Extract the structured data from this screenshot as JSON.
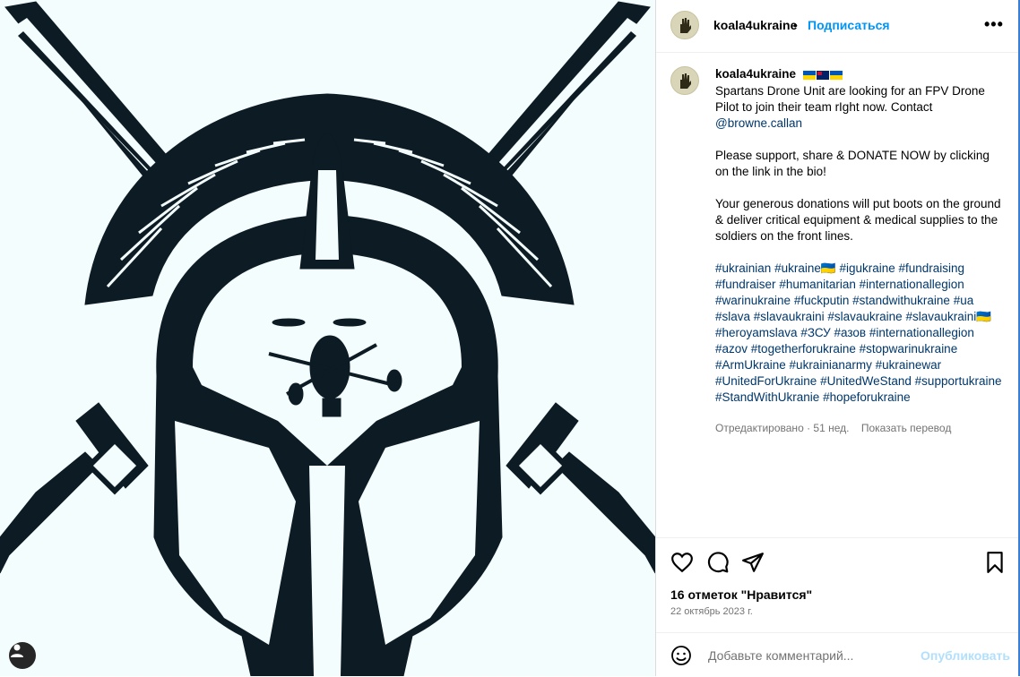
{
  "post": {
    "username": "koala4ukraine",
    "follow_label": "Подписаться",
    "more_label": "•••",
    "header_separator": "•",
    "avatar_icon": "hand-emblem-icon"
  },
  "caption": {
    "username": "koala4ukraine",
    "flags": [
      "ukraine-flag",
      "australia-flag",
      "ukraine-flag"
    ],
    "line1": "Spartans Drone Unit are looking for an FPV Drone Pilot to join their team rIght now. Contact ",
    "mention": "@browne.callan",
    "para2": "Please support, share & DONATE NOW by clicking on the link in the bio!",
    "para3": "Your generous donations will put boots on the ground & deliver critical equipment & medical supplies to the soldiers on the front lines.",
    "hashtags": [
      "#ukrainian",
      "#ukraine🇺🇦",
      "#igukraine",
      "#fundraising",
      "#fundraiser",
      "#humanitarian",
      "#internationallegion",
      "#warinukraine",
      "#fuckputin",
      "#standwithukraine",
      "#ua",
      "#slava",
      "#slavaukraini",
      "#slavaukraine",
      "#slavaukraini🇺🇦",
      "#heroyamslava",
      "#ЗСУ",
      "#азов",
      "#internationallegion",
      "#azov",
      "#togetherforukraine",
      "#stopwarinukraine",
      "#ArmUkraine",
      "#ukrainianarmy",
      "#ukrainewar",
      "#UnitedForUkraine",
      "#UnitedWeStand",
      "#supportukraine",
      "#StandWithUkranie",
      "#hopeforukraine"
    ],
    "meta_edited": "Отредактировано · 51 нед.",
    "translate_label": "Показать перевод"
  },
  "actions": {
    "like_icon": "heart-icon",
    "comment_icon": "comment-icon",
    "share_icon": "paper-plane-icon",
    "save_icon": "bookmark-icon"
  },
  "likes_text": "16 отметок \"Нравится\"",
  "date_text": "22 октябрь 2023 г.",
  "comment": {
    "placeholder": "Добавьте комментарий...",
    "publish_label": "Опубликовать",
    "emoji_icon": "smiley-icon"
  },
  "media": {
    "description_icon": "spartan-helmet-drone-image",
    "profile_icon": "user-profile-icon"
  },
  "colors": {
    "link": "#00376b",
    "accent": "#0095f6",
    "publish_disabled": "#b2dffc",
    "muted": "#737373",
    "artwork_ink": "#0d1b24",
    "artwork_bg": "#f4fdfd"
  }
}
